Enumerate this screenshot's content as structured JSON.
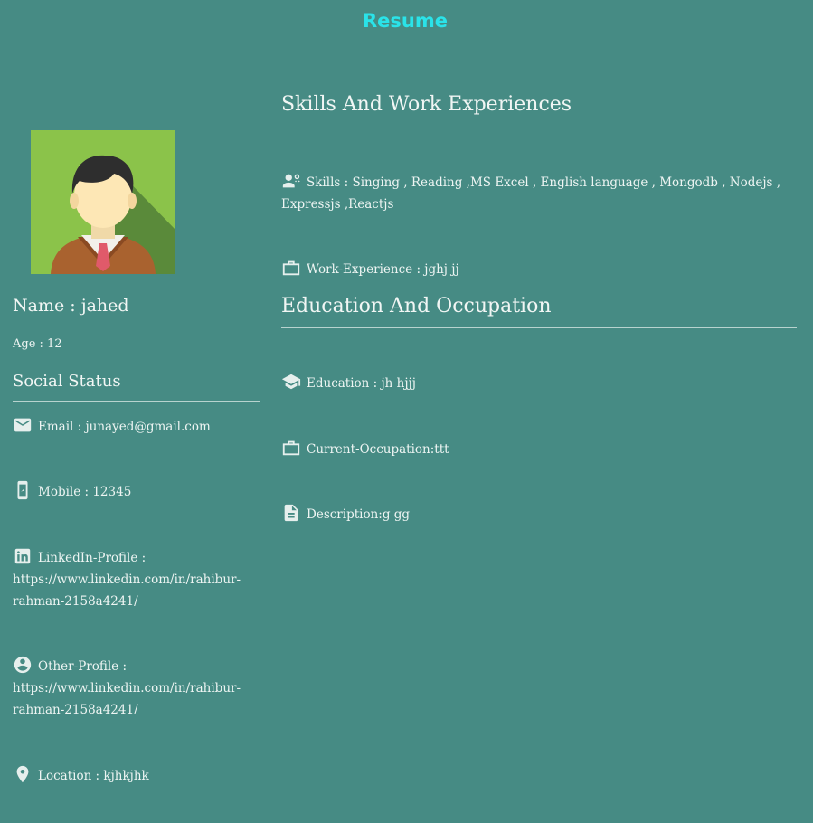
{
  "header": {
    "title": "Resume"
  },
  "profile": {
    "name": "Name : jahed",
    "age": "Age : 12"
  },
  "social": {
    "heading": "Social Status",
    "email": "Email : junayed@gmail.com",
    "mobile": "Mobile : 12345",
    "linkedin_label": "LinkedIn-Profile :",
    "linkedin_url_1": "https://www.linkedin.com/in/rahibur-",
    "linkedin_url_2": "rahman-2158a4241/",
    "other_label": "Other-Profile :",
    "other_url_1": "https://www.linkedin.com/in/rahibur-",
    "other_url_2": "rahman-2158a4241/",
    "location": "Location : kjhkjhk"
  },
  "skills_section": {
    "heading": "Skills And Work Experiences",
    "skills_1": "Skills : Singing , Reading ,MS Excel , English language , Mongodb , Nodejs ,",
    "skills_2": "Expressjs ,Reactjs",
    "work": "Work-Experience : jghj jj"
  },
  "education_section": {
    "heading": "Education And Occupation",
    "education": "Education : jh hjjj",
    "occupation": "Current-Occupation:ttt",
    "description": "Description:g gg"
  },
  "colors": {
    "background": "#468b84",
    "title": "#2ae3e9",
    "photo_bg": "#8bc34a"
  },
  "icons": [
    "avatar-icon",
    "email-icon",
    "mobile-icon",
    "linkedin-icon",
    "account-circle-icon",
    "location-pin-icon",
    "skills-icon",
    "briefcase-icon",
    "school-icon",
    "document-icon"
  ]
}
